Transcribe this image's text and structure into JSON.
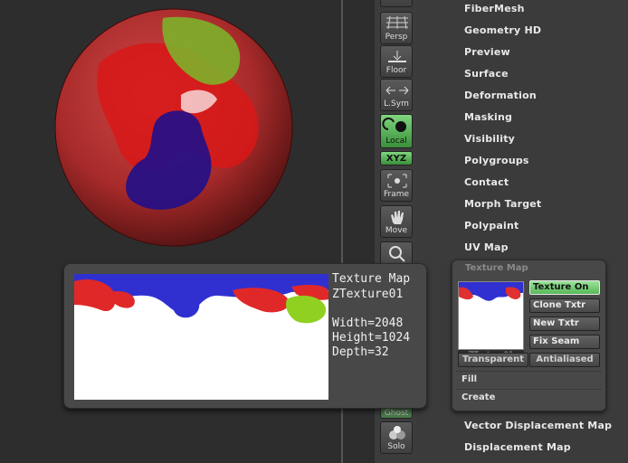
{
  "shelf": {
    "persp": "Persp",
    "floor": "Floor",
    "lsym": "L.Sym",
    "local": "Local",
    "xyz": "XYZ",
    "frame": "Frame",
    "move": "Move",
    "ghost": "Ghost",
    "solo": "Solo"
  },
  "menu": {
    "items_top": [
      "FiberMesh",
      "Geometry HD",
      "Preview",
      "Surface",
      "Deformation",
      "Masking",
      "Visibility",
      "Polygroups",
      "Contact",
      "Morph Target",
      "Polypaint",
      "UV Map"
    ],
    "items_bottom": [
      "Vector Displacement Map",
      "Displacement Map"
    ]
  },
  "texture_panel": {
    "title": "Texture Map",
    "thumb_name": "ZTexture01",
    "texture_on": "Texture On",
    "clone_txtr": "Clone Txtr",
    "new_txtr": "New Txtr",
    "fix_seam": "Fix Seam",
    "transparent": "Transparent",
    "antialiased": "Antialiased",
    "fill": "Fill",
    "create": "Create"
  },
  "popup": {
    "title": "Texture Map",
    "name": "ZTexture01",
    "width": "Width=2048",
    "height": "Height=1024",
    "depth": "Depth=32"
  },
  "colors": {
    "active_green": "#7fd67f",
    "paint_red": "#e02020",
    "paint_blue": "#2020c8",
    "paint_green": "#90d020"
  }
}
